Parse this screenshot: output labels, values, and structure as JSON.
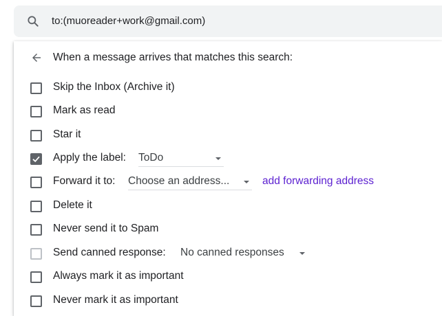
{
  "search": {
    "query": "to:(muoreader+work@gmail.com)",
    "icon": "search-icon"
  },
  "filter_panel": {
    "heading": "When a message arrives that matches this search:",
    "options": [
      {
        "label": "Skip the Inbox (Archive it)",
        "checked": false
      },
      {
        "label": "Mark as read",
        "checked": false
      },
      {
        "label": "Star it",
        "checked": false
      },
      {
        "label": "Apply the label:",
        "checked": true,
        "dropdown_value": "ToDo"
      },
      {
        "label": "Forward it to:",
        "checked": false,
        "dropdown_value": "Choose an address...",
        "link": "add forwarding address"
      },
      {
        "label": "Delete it",
        "checked": false
      },
      {
        "label": "Never send it to Spam",
        "checked": false
      },
      {
        "label": "Send canned response:",
        "checked": false,
        "disabled": true,
        "dropdown_value": "No canned responses"
      },
      {
        "label": "Always mark it as important",
        "checked": false
      },
      {
        "label": "Never mark it as important",
        "checked": false
      }
    ]
  },
  "colors": {
    "link": "#5b1fd0",
    "checkbox": "#5f6368",
    "searchbar_bg": "#f1f3f4"
  }
}
